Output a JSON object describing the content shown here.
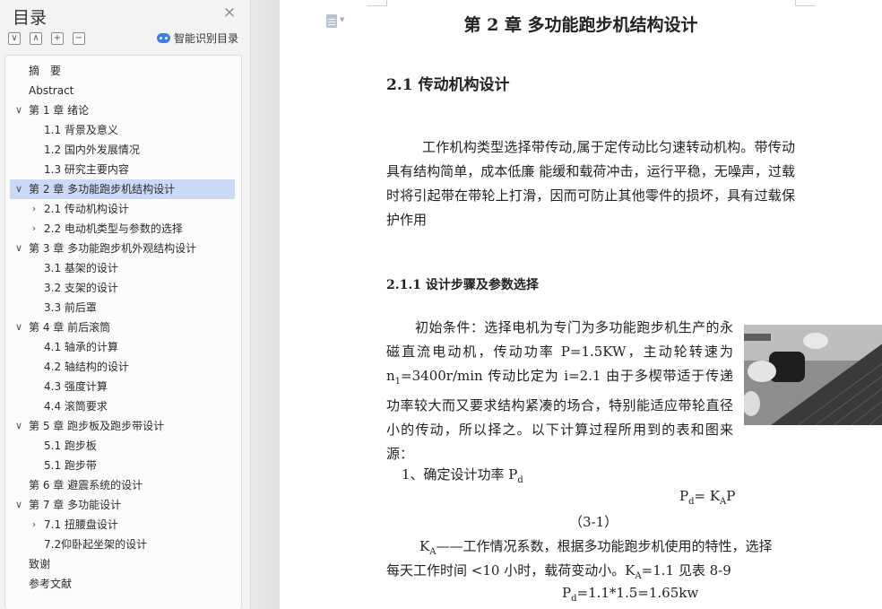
{
  "sidebar": {
    "title": "目录",
    "smart_toc_label": "智能识别目录",
    "tools": [
      "∨",
      "∧",
      "+",
      "−"
    ],
    "items": [
      {
        "label": "摘　要",
        "level": 1,
        "arrow": ""
      },
      {
        "label": "Abstract",
        "level": 1,
        "arrow": ""
      },
      {
        "label": "第 1 章  绪论",
        "level": 1,
        "arrow": "∨"
      },
      {
        "label": "1.1 背景及意义",
        "level": 2,
        "arrow": ""
      },
      {
        "label": "1.2 国内外发展情况",
        "level": 2,
        "arrow": ""
      },
      {
        "label": "1.3 研究主要内容",
        "level": 2,
        "arrow": ""
      },
      {
        "label": "第 2 章  多功能跑步机结构设计",
        "level": 1,
        "arrow": "∨",
        "selected": true
      },
      {
        "label": "2.1  传动机构设计",
        "level": 2,
        "arrow": "›"
      },
      {
        "label": "2.2  电动机类型与参数的选择",
        "level": 2,
        "arrow": "›"
      },
      {
        "label": "第 3 章  多功能跑步机外观结构设计",
        "level": 1,
        "arrow": "∨"
      },
      {
        "label": "3.1 基架的设计",
        "level": 2,
        "arrow": ""
      },
      {
        "label": "3.2 支架的设计",
        "level": 2,
        "arrow": ""
      },
      {
        "label": "3.3 前后罩",
        "level": 2,
        "arrow": ""
      },
      {
        "label": "第 4 章  前后滚筒",
        "level": 1,
        "arrow": "∨"
      },
      {
        "label": "4.1 轴承的计算",
        "level": 2,
        "arrow": ""
      },
      {
        "label": "4.2 轴结构的设计",
        "level": 2,
        "arrow": ""
      },
      {
        "label": "4.3 强度计算",
        "level": 2,
        "arrow": ""
      },
      {
        "label": "4.4 滚筒要求",
        "level": 2,
        "arrow": ""
      },
      {
        "label": "第 5 章  跑步板及跑步带设计",
        "level": 1,
        "arrow": "∨"
      },
      {
        "label": "5.1 跑步板",
        "level": 2,
        "arrow": ""
      },
      {
        "label": "5.1 跑步带",
        "level": 2,
        "arrow": ""
      },
      {
        "label": "第 6 章  避震系统的设计",
        "level": 1,
        "arrow": ""
      },
      {
        "label": "第 7 章  多功能设计",
        "level": 1,
        "arrow": "∨"
      },
      {
        "label": "7.1 扭腰盘设计",
        "level": 2,
        "arrow": "›"
      },
      {
        "label": "7.2仰卧起坐架的设计",
        "level": 2,
        "arrow": ""
      },
      {
        "label": "致谢",
        "level": 1,
        "arrow": ""
      },
      {
        "label": "参考文献",
        "level": 1,
        "arrow": ""
      }
    ]
  },
  "doc": {
    "chapter_title": "第 2 章  多功能跑步机结构设计",
    "section_title": "2.1  传动机构设计",
    "para1": "工作机构类型选择带传动,属于定传动比匀速转动机构。带传动具有结构简单，成本低廉  能缓和载荷冲击，运行平稳，无噪声，过载时将引起带在带轮上打滑，因而可防止其他零件的损坏，具有过载保护作用",
    "subsection_title": "2.1.1  设计步骤及参数选择",
    "para2_a": "初始条件：选择电机为专门为多功能跑步机生产的永磁直流电动机，传动功率 P=1.5KW，主动轮转速为 n",
    "para2_sub": "1",
    "para2_b": "=3400r/min  传动比定为 i=2.1  由于多楔带适于传递功率较大而又要求结构紧凑的场合，特别能适应带轮直径小的传动，所以择之。以下计算过程所用到的表和图来源：",
    "step1_a": "1、确定设计功率 P",
    "step1_sub": "d",
    "formula_a": "P",
    "formula_sub1": "d",
    "formula_b": "= K",
    "formula_sub2": "A",
    "formula_c": "P",
    "eq_number": "（3-1）",
    "ka_a": "K",
    "ka_sub": "A",
    "ka_b": "——工作情况系数，根据多功能跑步机使用的特性，选择",
    "ka_line2_a": "每天工作时间 <10 小时，载荷变动小。K",
    "ka_line2_sub": "A",
    "ka_line2_b": "=1.1 见表 8-9",
    "calc_a": "P",
    "calc_sub": "d",
    "calc_b": "=1.1*1.5=1.65kw"
  }
}
